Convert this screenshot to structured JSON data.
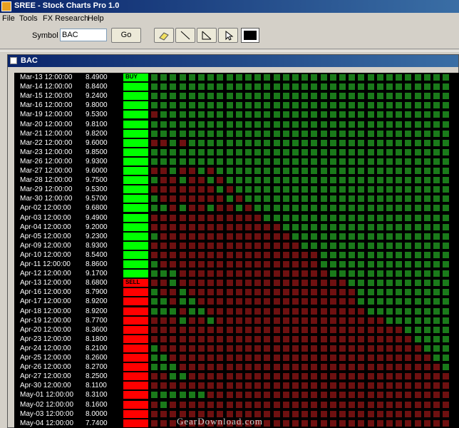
{
  "window": {
    "title": "SREE - Stock Charts Pro 1.0"
  },
  "menu": [
    "File",
    "Tools",
    "FX Research",
    "Help"
  ],
  "toolbar": {
    "symbol_label": "Symbol :",
    "symbol_value": "BAC",
    "go_label": "Go",
    "tools": [
      "eraser-icon",
      "line-icon",
      "angle-icon",
      "pointer-icon"
    ],
    "color": "#000000"
  },
  "chart_window": {
    "title": "BAC"
  },
  "signals": {
    "buy": "BUY",
    "sell": "SELL",
    "buy_color": "#00ff00",
    "sell_color": "#ff0000"
  },
  "cell_colors": {
    "up": "#1a7a1a",
    "down": "#6e1010",
    "empty": "#000000"
  },
  "rows": [
    {
      "date": "Mar-13 12:00:00",
      "price": "8.4900",
      "signal": "buy",
      "first": true
    },
    {
      "date": "Mar-14 12:00:00",
      "price": "8.8400",
      "signal": "buy"
    },
    {
      "date": "Mar-15 12:00:00",
      "price": "9.2400",
      "signal": "buy"
    },
    {
      "date": "Mar-16 12:00:00",
      "price": "9.8000",
      "signal": "buy"
    },
    {
      "date": "Mar-19 12:00:00",
      "price": "9.5300",
      "signal": "buy"
    },
    {
      "date": "Mar-20 12:00:00",
      "price": "9.8100",
      "signal": "buy"
    },
    {
      "date": "Mar-21 12:00:00",
      "price": "9.8200",
      "signal": "buy"
    },
    {
      "date": "Mar-22 12:00:00",
      "price": "9.6000",
      "signal": "buy"
    },
    {
      "date": "Mar-23 12:00:00",
      "price": "9.8500",
      "signal": "buy"
    },
    {
      "date": "Mar-26 12:00:00",
      "price": "9.9300",
      "signal": "buy"
    },
    {
      "date": "Mar-27 12:00:00",
      "price": "9.6000",
      "signal": "buy"
    },
    {
      "date": "Mar-28 12:00:00",
      "price": "9.7500",
      "signal": "buy"
    },
    {
      "date": "Mar-29 12:00:00",
      "price": "9.5300",
      "signal": "buy"
    },
    {
      "date": "Mar-30 12:00:00",
      "price": "9.5700",
      "signal": "buy"
    },
    {
      "date": "Apr-02 12:00:00",
      "price": "9.6800",
      "signal": "buy"
    },
    {
      "date": "Apr-03 12:00:00",
      "price": "9.4900",
      "signal": "buy"
    },
    {
      "date": "Apr-04 12:00:00",
      "price": "9.2000",
      "signal": "buy"
    },
    {
      "date": "Apr-05 12:00:00",
      "price": "9.2300",
      "signal": "buy"
    },
    {
      "date": "Apr-09 12:00:00",
      "price": "8.9300",
      "signal": "buy"
    },
    {
      "date": "Apr-10 12:00:00",
      "price": "8.5400",
      "signal": "buy"
    },
    {
      "date": "Apr-11 12:00:00",
      "price": "8.8600",
      "signal": "buy"
    },
    {
      "date": "Apr-12 12:00:00",
      "price": "9.1700",
      "signal": "buy"
    },
    {
      "date": "Apr-13 12:00:00",
      "price": "8.6800",
      "signal": "sell",
      "first": true
    },
    {
      "date": "Apr-16 12:00:00",
      "price": "8.7900",
      "signal": "sell"
    },
    {
      "date": "Apr-17 12:00:00",
      "price": "8.9200",
      "signal": "sell"
    },
    {
      "date": "Apr-18 12:00:00",
      "price": "8.9200",
      "signal": "sell"
    },
    {
      "date": "Apr-19 12:00:00",
      "price": "8.7700",
      "signal": "sell"
    },
    {
      "date": "Apr-20 12:00:00",
      "price": "8.3600",
      "signal": "sell"
    },
    {
      "date": "Apr-23 12:00:00",
      "price": "8.1800",
      "signal": "sell"
    },
    {
      "date": "Apr-24 12:00:00",
      "price": "8.2100",
      "signal": "sell"
    },
    {
      "date": "Apr-25 12:00:00",
      "price": "8.2600",
      "signal": "sell"
    },
    {
      "date": "Apr-26 12:00:00",
      "price": "8.2700",
      "signal": "sell"
    },
    {
      "date": "Apr-27 12:00:00",
      "price": "8.2500",
      "signal": "sell"
    },
    {
      "date": "Apr-30 12:00:00",
      "price": "8.1100",
      "signal": "sell"
    },
    {
      "date": "May-01 12:00:00",
      "price": "8.3100",
      "signal": "sell"
    },
    {
      "date": "May-02 12:00:00",
      "price": "8.1600",
      "signal": "sell"
    },
    {
      "date": "May-03 12:00:00",
      "price": "8.0000",
      "signal": "sell"
    },
    {
      "date": "May-04 12:00:00",
      "price": "7.7400",
      "signal": "sell"
    }
  ],
  "watermark": "GearDownload.com"
}
